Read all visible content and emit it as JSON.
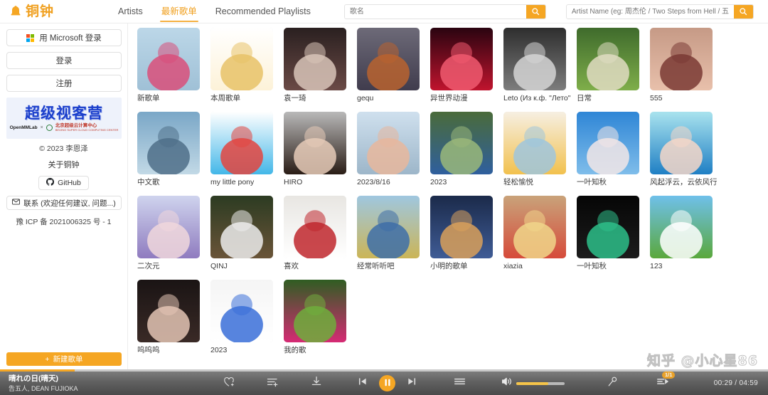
{
  "header": {
    "brand": "铜钟",
    "brand_icon": "bell-icon",
    "brand_color": "#f0a020",
    "nav": [
      {
        "label": "Artists",
        "active": false
      },
      {
        "label": "最新歌单",
        "active": true
      },
      {
        "label": "Recommended Playlists",
        "active": false
      }
    ],
    "song_search": {
      "placeholder": "歌名",
      "value": ""
    },
    "artist_search": {
      "placeholder": "Artist Name (eg: 周杰伦 / Two Steps from Hell / 五月天 / Bey...",
      "value": ""
    },
    "search_icon": "search-icon"
  },
  "sidebar": {
    "microsoft_login": "用 Microsoft 登录",
    "login": "登录",
    "register": "注册",
    "banner": {
      "title": "超级视客营",
      "left_logo": "OpenMMLab",
      "separator": "×",
      "right_logo_cn": "北京超级云计算中心",
      "right_logo_en": "BEIJING SUPER CLOUD COMPUTING CENTER"
    },
    "copyright": "© 2023 李恩泽",
    "about": "关于铜钟",
    "github": "GitHub",
    "contact": "联系 (欢迎任何建议, 问题...)",
    "icp": "豫 ICP 备 2021006325 号 - 1",
    "new_playlist": "新建歌单"
  },
  "main": {
    "cards": [
      {
        "label": "新歌单",
        "art": "boy-sunglasses-boat"
      },
      {
        "label": "本周歌单",
        "art": "blond-cartoon-face"
      },
      {
        "label": "袁一琦",
        "art": "two-women-portrait"
      },
      {
        "label": "gequ",
        "art": "anime-collage"
      },
      {
        "label": "异世界动漫",
        "art": "red-anime-creature"
      },
      {
        "label": "Leto (Из к.ф. \"Лето\"",
        "art": "leto-film-poster"
      },
      {
        "label": "日常",
        "art": "duckling-plants"
      },
      {
        "label": "555",
        "art": "woman-selfie"
      },
      {
        "label": "中文歌",
        "art": "woman-lake-mountains"
      },
      {
        "label": "my little pony",
        "art": "rainbow-dash-pony"
      },
      {
        "label": "HIRO",
        "art": "retro-woman-portrait"
      },
      {
        "label": "2023/8/16",
        "art": "snow-mountain-forest"
      },
      {
        "label": "2023",
        "art": "blue-crab-toy"
      },
      {
        "label": "轻松愉悦",
        "art": "pastel-flowers"
      },
      {
        "label": "一叶知秋",
        "art": "cherry-blossom-sky"
      },
      {
        "label": "风起浮云，云依风行",
        "art": "anime-blue-eyes"
      },
      {
        "label": "二次元",
        "art": "anime-girl-white-hair"
      },
      {
        "label": "QINJ",
        "art": "panda-tree"
      },
      {
        "label": "喜欢",
        "art": "boston-sneakers"
      },
      {
        "label": "经常听听吧",
        "art": "boy-field-arms-open"
      },
      {
        "label": "小明的歌单",
        "art": "boy-dog-night"
      },
      {
        "label": "xiazia",
        "art": "food-table"
      },
      {
        "label": "一叶知秋",
        "art": "dark-astronaut"
      },
      {
        "label": "123",
        "art": "countryside-illustration"
      },
      {
        "label": "呜呜呜",
        "art": "woman-dark-hair"
      },
      {
        "label": "2023",
        "art": "network-config-text"
      },
      {
        "label": "我的歌",
        "art": "pink-peonies"
      }
    ]
  },
  "watermark": "知乎 @小心星86",
  "player": {
    "track_title": "晴れの日(晴天)",
    "track_artist": "告五人, DEAN FUJIOKA",
    "favorite_icon": "heart-plus-icon",
    "add_to_list_icon": "add-to-playlist-icon",
    "download_icon": "download-icon",
    "prev_icon": "previous-track-icon",
    "play_pause_icon": "pause-icon",
    "next_icon": "next-track-icon",
    "lyrics_icon": "lyrics-icon",
    "volume_icon": "volume-icon",
    "volume_percent": 66,
    "mic_icon": "microphone-icon",
    "queue_icon": "queue-icon",
    "queue_badge": "1/1",
    "current_time": "00:29",
    "total_time": "04:59",
    "time_display": "00:29 / 04:59",
    "progress_percent": 9.7,
    "accent_color": "#f5a623"
  }
}
